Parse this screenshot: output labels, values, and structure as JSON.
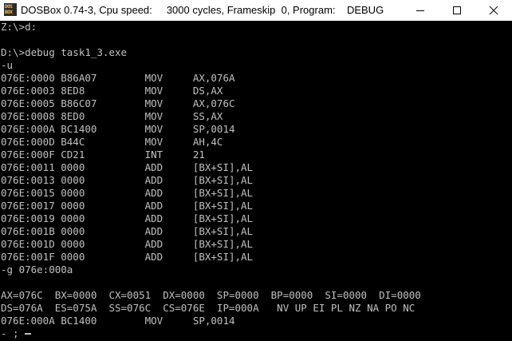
{
  "window": {
    "title": "DOSBox 0.74-3, Cpu speed:     3000 cycles, Frameskip  0, Program:    DEBUG",
    "icon": "dosbox-icon",
    "icon_text": [
      "DOS",
      "BOX"
    ]
  },
  "terminal": {
    "lines": [
      "Z:\\>d:",
      "",
      "D:\\>debug task1_3.exe",
      "-u",
      "076E:0000 B86A07        MOV     AX,076A",
      "076E:0003 8ED8          MOV     DS,AX",
      "076E:0005 B86C07        MOV     AX,076C",
      "076E:0008 8ED0          MOV     SS,AX",
      "076E:000A BC1400        MOV     SP,0014",
      "076E:000D B44C          MOV     AH,4C",
      "076E:000F CD21          INT     21",
      "076E:0011 0000          ADD     [BX+SI],AL",
      "076E:0013 0000          ADD     [BX+SI],AL",
      "076E:0015 0000          ADD     [BX+SI],AL",
      "076E:0017 0000          ADD     [BX+SI],AL",
      "076E:0019 0000          ADD     [BX+SI],AL",
      "076E:001B 0000          ADD     [BX+SI],AL",
      "076E:001D 0000          ADD     [BX+SI],AL",
      "076E:001F 0000          ADD     [BX+SI],AL",
      "-g 076e:000a",
      "",
      "AX=076C  BX=0000  CX=0051  DX=0000  SP=0000  BP=0000  SI=0000  DI=0000",
      "DS=076A  ES=075A  SS=076C  CS=076E  IP=000A   NV UP EI PL NZ NA PO NC",
      "076E:000A BC1400        MOV     SP,0014",
      "- ;"
    ]
  },
  "colors": {
    "terminal_bg": "#000000",
    "terminal_fg": "#c0c0c0",
    "titlebar_bg": "#ffffff"
  }
}
